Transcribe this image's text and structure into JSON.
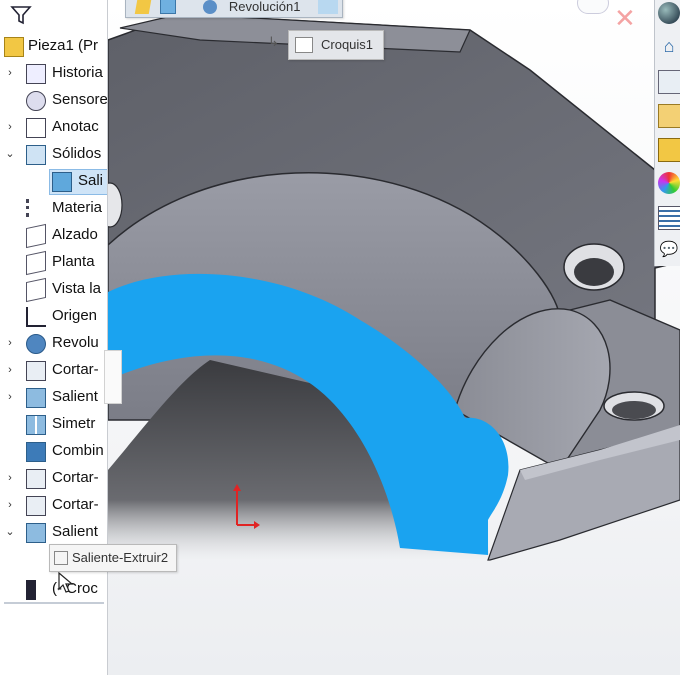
{
  "feature_tree": {
    "root_label": "Pieza1  (Pr",
    "items": [
      {
        "label": "Historia",
        "icon": "history-icon",
        "expander": "›"
      },
      {
        "label": "Sensores",
        "icon": "sensors-icon",
        "expander": ""
      },
      {
        "label": "Anotac",
        "icon": "annotations-icon",
        "expander": "›"
      },
      {
        "label": "Sólidos",
        "icon": "solid-bodies-icon",
        "expander": "⌄"
      },
      {
        "label": "Sali",
        "icon": "body-icon",
        "expander": ""
      },
      {
        "label": "Materia",
        "icon": "material-icon",
        "expander": ""
      },
      {
        "label": "Alzado",
        "icon": "plane-icon",
        "expander": ""
      },
      {
        "label": "Planta",
        "icon": "plane-icon",
        "expander": ""
      },
      {
        "label": "Vista la",
        "icon": "plane-icon",
        "expander": ""
      },
      {
        "label": "Origen",
        "icon": "origin-icon",
        "expander": ""
      },
      {
        "label": "Revolu",
        "icon": "revolve-icon",
        "expander": "›"
      },
      {
        "label": "Cortar-",
        "icon": "cut-icon",
        "expander": "›"
      },
      {
        "label": "Salient",
        "icon": "extrude-icon",
        "expander": "›"
      },
      {
        "label": "Simetr",
        "icon": "mirror-icon",
        "expander": ""
      },
      {
        "label": "Combin",
        "icon": "combine-icon",
        "expander": ""
      },
      {
        "label": "Cortar-",
        "icon": "cut-icon",
        "expander": "›"
      },
      {
        "label": "Cortar-",
        "icon": "cut-icon",
        "expander": "›"
      },
      {
        "label": "Salient",
        "icon": "extrude-icon",
        "expander": "⌄"
      }
    ],
    "sketch_child_label": "(- Croc"
  },
  "tooltips": {
    "top_feature": "Revolución1",
    "top_sketch": "Croquis1",
    "hover_feature": "Saliente-Extruir2"
  },
  "colors": {
    "highlight": "#1aa3f0",
    "model_gray": "#6e7079",
    "selection": "#cfe4f7"
  }
}
